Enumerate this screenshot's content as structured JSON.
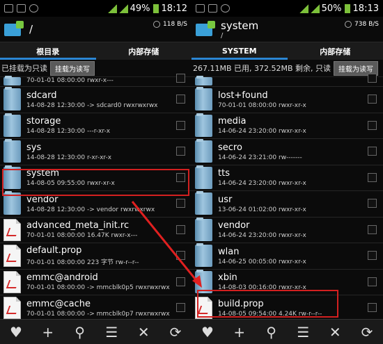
{
  "left": {
    "status": {
      "battery": "49%",
      "time": "18:12"
    },
    "path": {
      "title": "/",
      "subtitle": ""
    },
    "speed": "118 B/S",
    "tabs": [
      {
        "label": "根目录",
        "active": true
      },
      {
        "label": "内部存储",
        "active": false
      }
    ],
    "mount": {
      "text": "已挂载为只读",
      "button": "挂载为读写"
    },
    "rows": [
      {
        "type": "folder",
        "name": "",
        "meta": "70-01-01 08:00:00   rwxr-x---",
        "partial": true
      },
      {
        "type": "folder",
        "name": "sdcard",
        "meta": "14-08-28 12:30:00  -> sdcard0  rwxrwxrwx"
      },
      {
        "type": "folder",
        "name": "storage",
        "meta": "14-08-28 12:30:00   ---r-xr-x"
      },
      {
        "type": "folder",
        "name": "sys",
        "meta": "14-08-28 12:30:00   r-xr-xr-x"
      },
      {
        "type": "folder",
        "name": "system",
        "meta": "14-08-05 09:55:00   rwxr-xr-x"
      },
      {
        "type": "folder",
        "name": "vendor",
        "meta": "14-08-28 12:30:00  -> vendor  rwxrwxrwx"
      },
      {
        "type": "file",
        "name": "advanced_meta_init.rc",
        "meta": "70-01-01 08:00:00  16.47K  rwxr-x---"
      },
      {
        "type": "file",
        "name": "default.prop",
        "meta": "70-01-01 08:00:00  223 字节  rw-r--r--"
      },
      {
        "type": "file",
        "name": "emmc@android",
        "meta": "70-01-01 08:00:00  -> mmcblk0p5  rwxrwxrwx"
      },
      {
        "type": "file",
        "name": "emmc@cache",
        "meta": "70-01-01 08:00:00  -> mmcblk0p7  rwxrwxrwx"
      }
    ]
  },
  "right": {
    "status": {
      "battery": "50%",
      "time": "18:13"
    },
    "path": {
      "title": "system",
      "subtitle": "/"
    },
    "speed": "738 B/S",
    "tabs": [
      {
        "label": "SYSTEM",
        "active": true
      },
      {
        "label": "内部存储",
        "active": false
      }
    ],
    "mount": {
      "text": "267.11MB 已用, 372.52MB 剩余, 只读",
      "button": "挂载为读写"
    },
    "rows": [
      {
        "type": "folder",
        "name": "",
        "meta": "",
        "partial": true
      },
      {
        "type": "folder",
        "name": "lost+found",
        "meta": "70-01-01 08:00:00   rwxr-xr-x"
      },
      {
        "type": "folder",
        "name": "media",
        "meta": "14-06-24 23:20:00   rwxr-xr-x"
      },
      {
        "type": "folder",
        "name": "secro",
        "meta": "14-06-24 23:21:00   rw-------"
      },
      {
        "type": "folder",
        "name": "tts",
        "meta": "14-06-24 23:20:00   rwxr-xr-x"
      },
      {
        "type": "folder",
        "name": "usr",
        "meta": "13-06-24 01:02:00   rwxr-xr-x"
      },
      {
        "type": "folder",
        "name": "vendor",
        "meta": "14-06-24 23:20:00   rwxr-xr-x"
      },
      {
        "type": "folder",
        "name": "wlan",
        "meta": "14-06-25 00:05:00   rwxr-xr-x"
      },
      {
        "type": "folder",
        "name": "xbin",
        "meta": "14-08-03 00:16:00   rwxr-xr-x"
      },
      {
        "type": "file",
        "name": "build.prop",
        "meta": "14-08-05 09:54:00  4.24K  rw-r--r--"
      }
    ]
  },
  "toolbar": [
    {
      "icon": "heart-icon",
      "glyph": "♥"
    },
    {
      "icon": "plus-icon",
      "glyph": "+"
    },
    {
      "icon": "search-icon",
      "glyph": "⚲"
    },
    {
      "icon": "sort-icon",
      "glyph": "☰"
    },
    {
      "icon": "close-icon",
      "glyph": "✕"
    },
    {
      "icon": "refresh-icon",
      "glyph": "⟳"
    }
  ],
  "colors": {
    "accent": "#2b86d4",
    "highlight": "#d32020",
    "signal": "#7cc03a"
  }
}
